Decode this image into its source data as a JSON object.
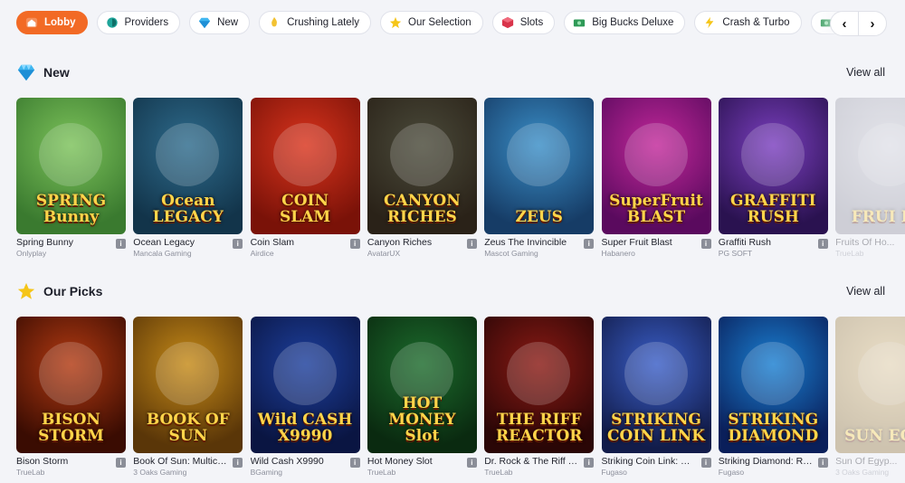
{
  "nav": {
    "chips": [
      {
        "label": "Lobby",
        "icon": "house-icon",
        "active": true
      },
      {
        "label": "Providers",
        "icon": "providers-icon"
      },
      {
        "label": "New",
        "icon": "diamond-icon"
      },
      {
        "label": "Crushing Lately",
        "icon": "flame-icon"
      },
      {
        "label": "Our Selection",
        "icon": "star-icon"
      },
      {
        "label": "Slots",
        "icon": "cube-icon"
      },
      {
        "label": "Big Bucks Deluxe",
        "icon": "money-icon"
      },
      {
        "label": "Crash & Turbo",
        "icon": "lightning-icon"
      }
    ],
    "prev": "‹",
    "next": "›"
  },
  "sections": [
    {
      "title": "New",
      "view_all": "View all",
      "games": [
        {
          "name": "Spring Bunny",
          "provider": "Onlyplay",
          "art": "SPRING Bunny",
          "bg": [
            "#7cc25a",
            "#3a7a2f"
          ]
        },
        {
          "name": "Ocean Legacy",
          "provider": "Mancala Gaming",
          "art": "Ocean LEGACY",
          "bg": [
            "#2e6b8c",
            "#12344a"
          ]
        },
        {
          "name": "Coin Slam",
          "provider": "Airdice",
          "art": "COIN SLAM",
          "bg": [
            "#d9341d",
            "#7a1208"
          ]
        },
        {
          "name": "Canyon Riches",
          "provider": "AvatarUX",
          "art": "CANYON RICHES",
          "bg": [
            "#4a4a3a",
            "#2a2218"
          ]
        },
        {
          "name": "Zeus The Invincible",
          "provider": "Mascot Gaming",
          "art": "ZEUS",
          "bg": [
            "#3a8ec7",
            "#163c66"
          ]
        },
        {
          "name": "Super Fruit Blast",
          "provider": "Habanero",
          "art": "SuperFruit BLAST",
          "bg": [
            "#c2289a",
            "#5a0a5e"
          ]
        },
        {
          "name": "Graffiti Rush",
          "provider": "PG SOFT",
          "art": "GRAFFITI RUSH",
          "bg": [
            "#7b3fbf",
            "#2a1250"
          ]
        },
        {
          "name": "Fruits Of Ho...",
          "provider": "TrueLab",
          "art": "FRUI HO",
          "bg": [
            "#c7c7d2",
            "#8a8a99"
          ]
        }
      ]
    },
    {
      "title": "Our Picks",
      "view_all": "View all",
      "games": [
        {
          "name": "Bison Storm",
          "provider": "TrueLab",
          "art": "BISON STORM",
          "bg": [
            "#b23a12",
            "#3a0c02"
          ]
        },
        {
          "name": "Book Of Sun: Multich...",
          "provider": "3 Oaks Gaming",
          "art": "BOOK OF SUN",
          "bg": [
            "#c58a18",
            "#5a3608"
          ]
        },
        {
          "name": "Wild Cash X9990",
          "provider": "BGaming",
          "art": "Wild CASH X9990",
          "bg": [
            "#1d3f9c",
            "#0a1542"
          ]
        },
        {
          "name": "Hot Money Slot",
          "provider": "TrueLab",
          "art": "HOT MONEY Slot",
          "bg": [
            "#1c6b2c",
            "#0a2a10"
          ]
        },
        {
          "name": "Dr. Rock & The Riff Re...",
          "provider": "TrueLab",
          "art": "THE RIFF REACTOR",
          "bg": [
            "#8a1a14",
            "#2a0606"
          ]
        },
        {
          "name": "Striking Coin Link: Ru...",
          "provider": "Fugaso",
          "art": "STRIKING COIN LINK",
          "bg": [
            "#3a5ec7",
            "#121c4a"
          ]
        },
        {
          "name": "Striking Diamond: Ru...",
          "provider": "Fugaso",
          "art": "STRIKING DIAMOND",
          "bg": [
            "#1a7fd1",
            "#0a1f5a"
          ]
        },
        {
          "name": "Sun Of Egyp...",
          "provider": "3 Oaks Gaming",
          "art": "SUN EGYP",
          "bg": [
            "#d9b56a",
            "#8a6a2a"
          ]
        }
      ]
    }
  ],
  "colors": {
    "accent": "#f26a25",
    "page_bg": "#f3f4f8"
  }
}
